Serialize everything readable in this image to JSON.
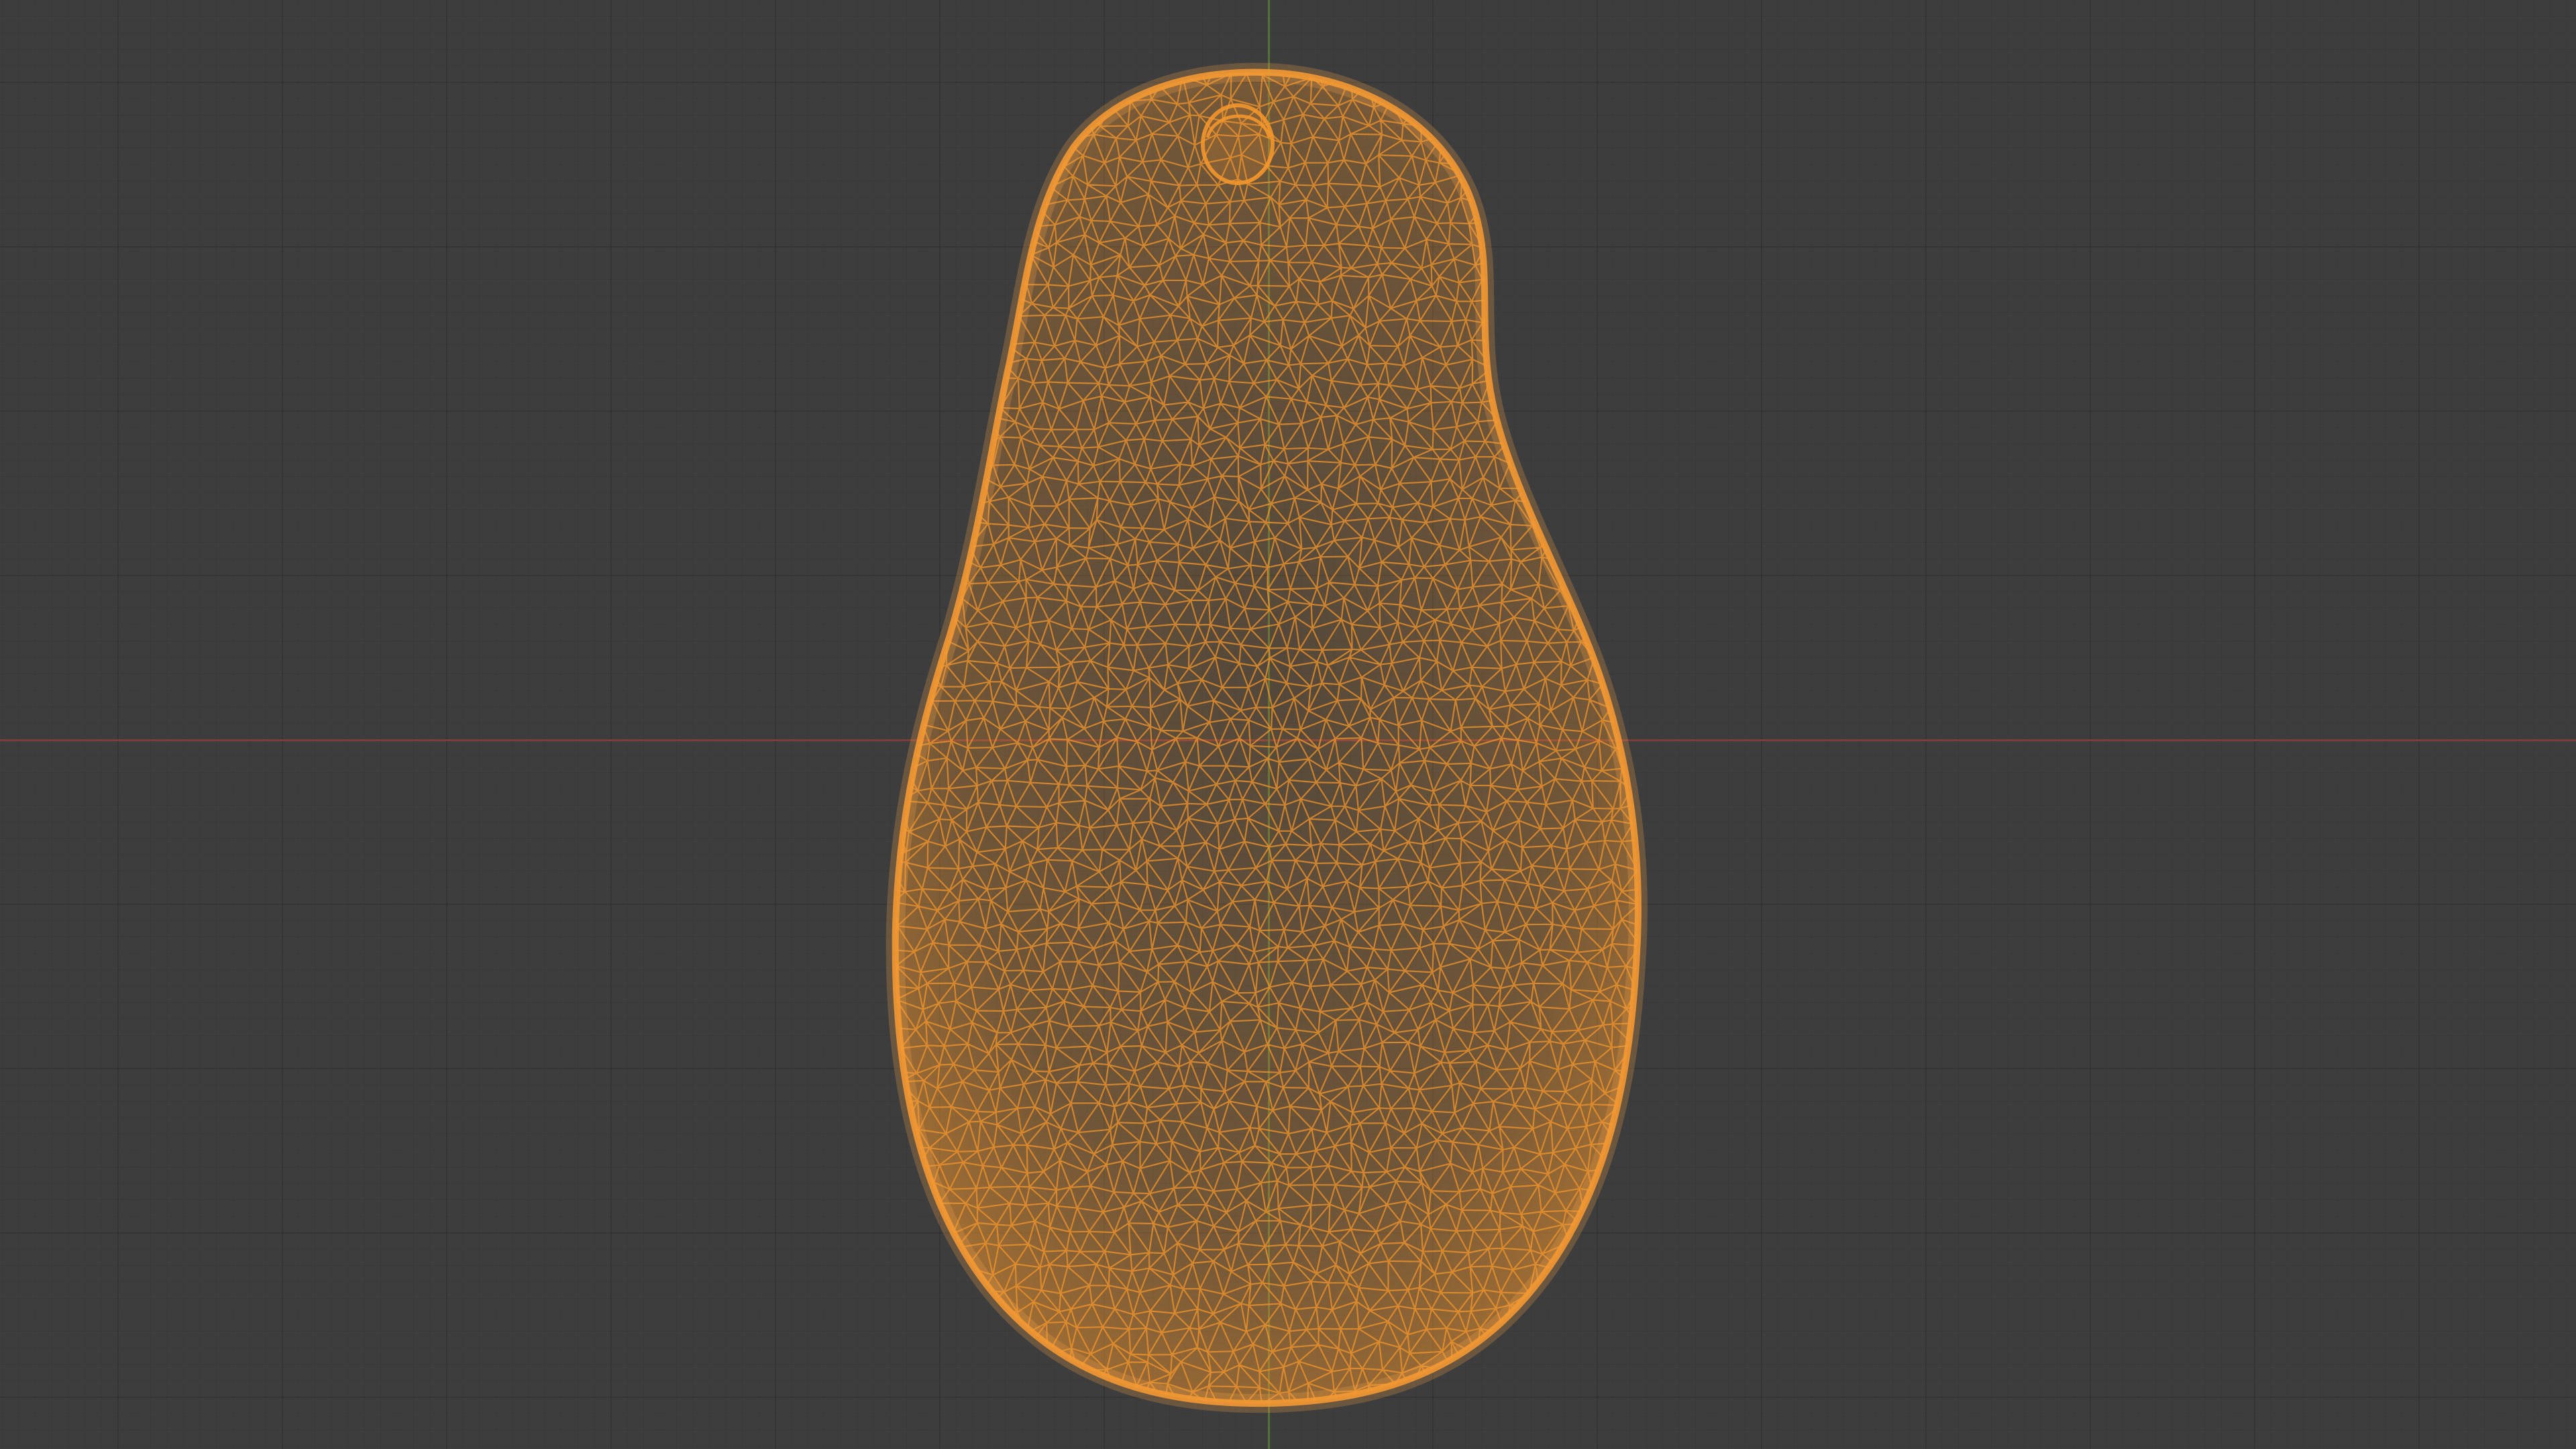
{
  "viewport": {
    "shading": "wireframe",
    "background_color": "#3d3d3d",
    "grid": true,
    "x_axis_color": "#8a3e3e",
    "y_axis_color": "#5a7a3a"
  },
  "object": {
    "shape": "avocado",
    "selected": true,
    "wire_color": "#f3962c"
  }
}
